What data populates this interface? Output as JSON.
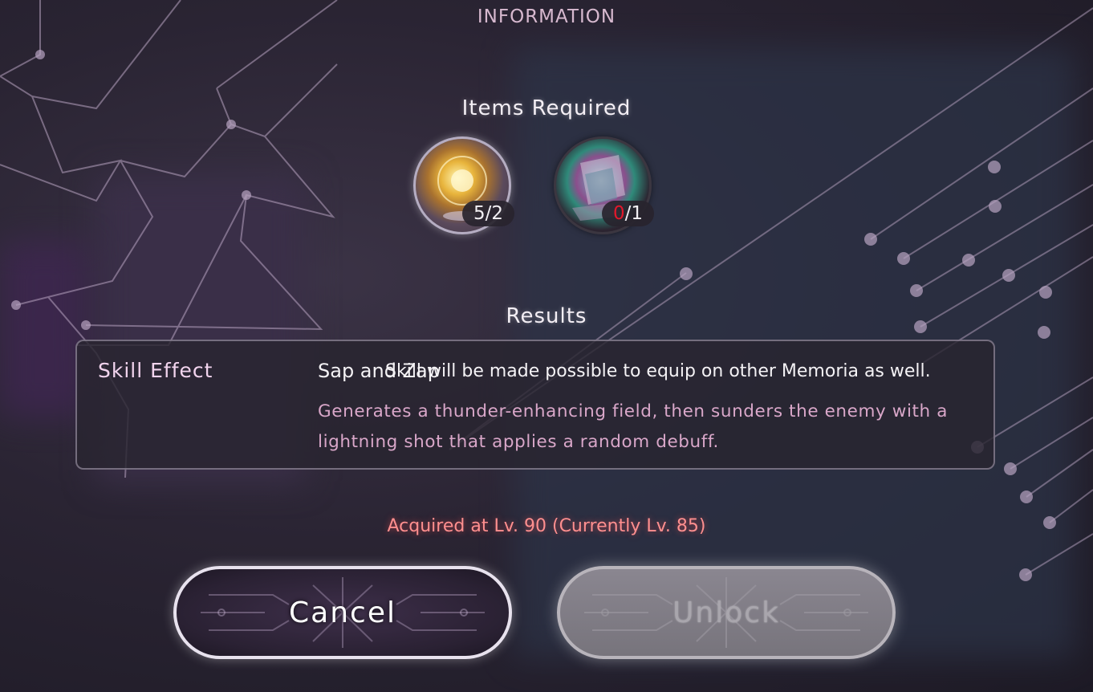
{
  "header": {
    "title": "INFORMATION"
  },
  "items_section": {
    "label": "Items Required",
    "items": [
      {
        "icon": "golden-orb-icon",
        "owned": "5",
        "separator": "/",
        "required": "2"
      },
      {
        "icon": "prism-memoria-icon",
        "owned": "0",
        "separator": "/",
        "required": "1",
        "owned_color": "#e2182b"
      }
    ]
  },
  "results_section": {
    "label": "Results",
    "skill_label": "Skill Effect",
    "skill_name": "Sap and Zap",
    "skill_note": "Skill will be made possible to equip on other Memoria as well.",
    "skill_description": "Generates a thunder-enhancing field, then sunders the enemy with a lightning shot that applies a random debuff."
  },
  "status": {
    "acquired_text": "Acquired at Lv. 90 (Currently Lv. 85)"
  },
  "buttons": {
    "cancel_label": "Cancel",
    "unlock_label": "Unlock"
  },
  "colors": {
    "accent_pink": "#d9a7c9",
    "warning_red": "#ff8f8f",
    "disabled_gray": "#8a8690"
  }
}
